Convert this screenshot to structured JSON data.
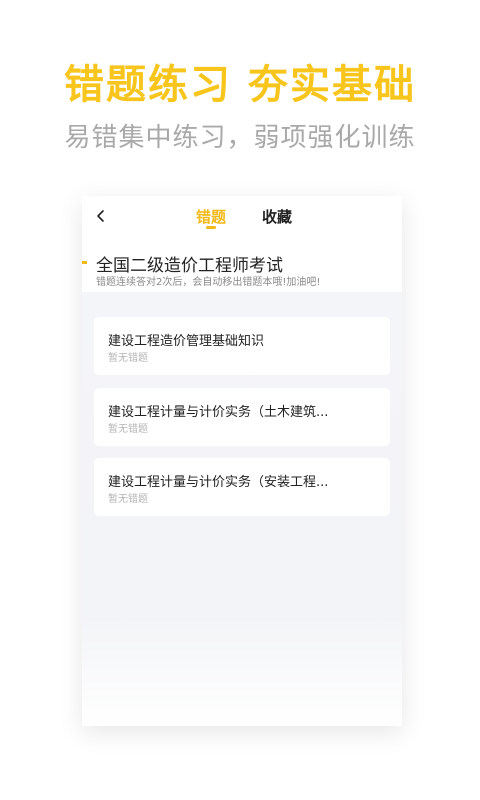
{
  "hero": {
    "title": "错题练习  夯实基础",
    "subtitle": "易错集中练习，弱项强化训练"
  },
  "nav": {
    "tabs": [
      {
        "label": "错题",
        "active": true
      },
      {
        "label": "收藏",
        "active": false
      }
    ]
  },
  "exam": {
    "title": "全国二级造价工程师考试",
    "hint": "错题连续答对2次后，会自动移出错题本哦!加油吧!"
  },
  "subjects": [
    {
      "name": "建设工程造价管理基础知识",
      "status": "暂无错题"
    },
    {
      "name": "建设工程计量与计价实务（土木建筑...",
      "status": "暂无错题"
    },
    {
      "name": "建设工程计量与计价实务（安装工程...",
      "status": "暂无错题"
    }
  ],
  "colors": {
    "accent": "#f2b91a",
    "hero_title": "#f7c51c",
    "subtitle": "#a9a9a9"
  },
  "icons": {
    "back": "chevron-left-icon"
  }
}
